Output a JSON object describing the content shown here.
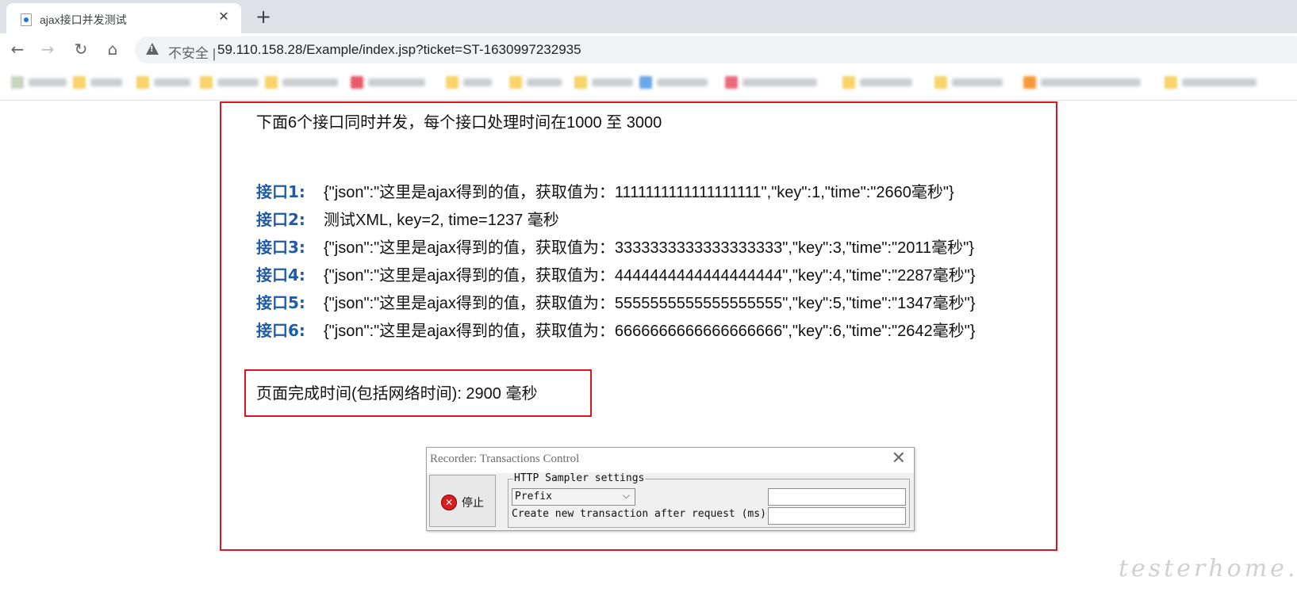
{
  "browser": {
    "tab_title": "ajax接口并发测试",
    "tab_close": "✕",
    "new_tab": "+",
    "back_icon": "←",
    "forward_icon": "→",
    "reload_icon": "↻",
    "home_icon": "⌂",
    "security_label": "不安全 |",
    "url": "59.110.158.28/Example/index.jsp?ticket=ST-1630997232935"
  },
  "page": {
    "intro": "下面6个接口同时并发，每个接口处理时间在1000 至 3000",
    "apis": [
      {
        "label": "接口1:",
        "value": "{\"json\":\"这里是ajax得到的值，获取值为：1111111111111111111\",\"key\":1,\"time\":\"2660毫秒\"}"
      },
      {
        "label": "接口2:",
        "value": "测试XML, key=2, time=1237 毫秒"
      },
      {
        "label": "接口3:",
        "value": "{\"json\":\"这里是ajax得到的值，获取值为：3333333333333333333\",\"key\":3,\"time\":\"2011毫秒\"}"
      },
      {
        "label": "接口4:",
        "value": "{\"json\":\"这里是ajax得到的值，获取值为：4444444444444444444\",\"key\":4,\"time\":\"2287毫秒\"}"
      },
      {
        "label": "接口5:",
        "value": "{\"json\":\"这里是ajax得到的值，获取值为：5555555555555555555\",\"key\":5,\"time\":\"1347毫秒\"}"
      },
      {
        "label": "接口6:",
        "value": "{\"json\":\"这里是ajax得到的值，获取值为：6666666666666666666\",\"key\":6,\"time\":\"2642毫秒\"}"
      }
    ],
    "complete_time": "页面完成时间(包括网络时间): 2900 毫秒",
    "accent_color": "#1f5ba8",
    "highlight_color": "#e0141f"
  },
  "recorder": {
    "title": "Recorder: Transactions Control",
    "close": "✕",
    "stop_icon": "✕",
    "stop_label": "停止",
    "group_label": "HTTP Sampler settings",
    "prefix_value": "Prefix",
    "chevron": "⌵",
    "create_label": "Create new transaction after request (ms):",
    "prefix_input_value": "",
    "ms_input_value": ""
  },
  "watermark": "testerhome.com"
}
